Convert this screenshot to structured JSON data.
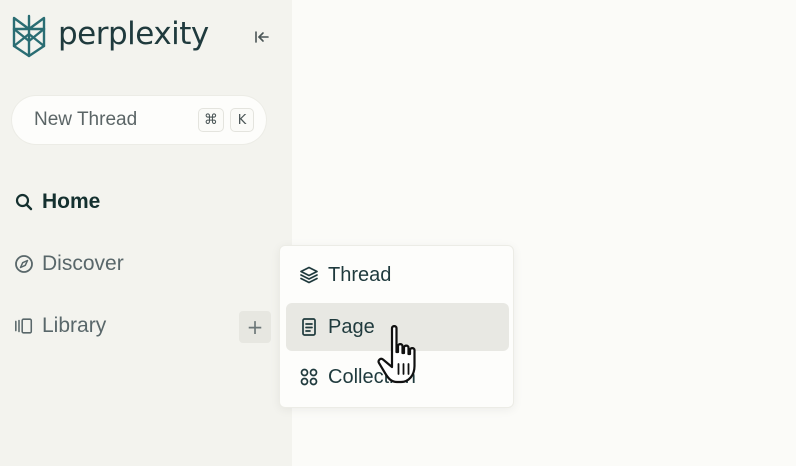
{
  "app": {
    "logo_text": "perplexity"
  },
  "sidebar": {
    "new_thread": {
      "label": "New Thread",
      "shortcut_cmd": "⌘",
      "shortcut_key": "K"
    },
    "nav": [
      {
        "label": "Home",
        "icon": "search-icon",
        "active": true
      },
      {
        "label": "Discover",
        "icon": "compass-icon",
        "active": false
      },
      {
        "label": "Library",
        "icon": "library-icon",
        "active": false
      }
    ],
    "add_symbol": "+"
  },
  "create_menu": {
    "items": [
      {
        "label": "Thread",
        "icon": "layers-icon"
      },
      {
        "label": "Page",
        "icon": "document-icon",
        "hovered": true
      },
      {
        "label": "Collection",
        "icon": "grid-circles-icon"
      }
    ]
  },
  "colors": {
    "sidebar_bg": "#f3f3ee",
    "main_bg": "#fbfbf8",
    "logo_teal": "#1f3a3d",
    "text_muted": "#59676a",
    "hover_bg": "#e8e8e3"
  }
}
